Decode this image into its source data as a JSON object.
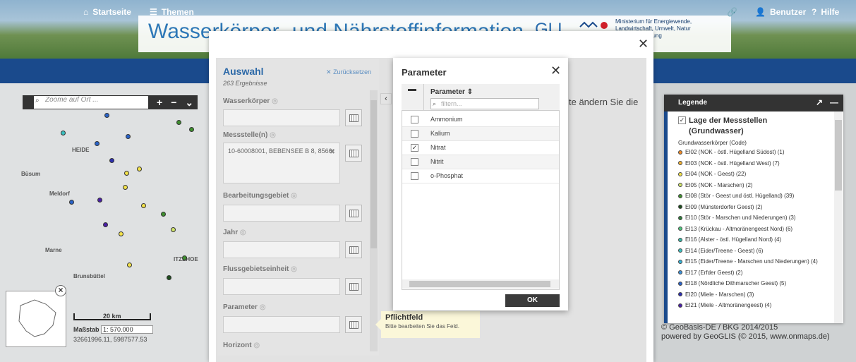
{
  "header": {
    "site_title": "Wasserkörper- und Nährstoffinformation",
    "brand": "GLI",
    "ministry_lines": [
      "Ministerium für Energiewende,",
      "Landwirtschaft, Umwelt, Natur",
      "und Digitalisierung"
    ],
    "nav": {
      "start": "Startseite",
      "themes": "Themen",
      "user": "Benutzer",
      "help": "Hilfe"
    }
  },
  "map": {
    "zoom_placeholder": "Zoome auf Ort ...",
    "scale_label": "20 km",
    "massstab_label": "Maßstab",
    "massstab_value": "1: 570.000",
    "coords": "32661996.11, 5987577.53",
    "places": [
      "HEIDE",
      "Meldorf",
      "Marne",
      "Brunsbüttel",
      "ITZEHOE",
      "Büsum"
    ],
    "background_text": "te ändern Sie die"
  },
  "auswahl": {
    "title": "Auswahl",
    "count": "263 Ergebnisse",
    "reset": "Zurücksetzen",
    "fields": {
      "wasserkoerper": "Wasserkörper",
      "messstelle": "Messstelle(n)",
      "bearbeitungsgebiet": "Bearbeitungsgebiet",
      "jahr": "Jahr",
      "flussgebietseinheit": "Flussgebietseinheit",
      "parameter": "Parameter",
      "horizont": "Horizont"
    },
    "messstelle_tag": "10-60008001, BEBENSEE B 8, 8566"
  },
  "tooltip": {
    "title": "Pflichtfeld",
    "message": "Bitte bearbeiten Sie das Feld."
  },
  "parameter_dialog": {
    "title": "Parameter",
    "column": "Parameter",
    "filter_placeholder": "filtern...",
    "rows": [
      {
        "label": "Ammonium",
        "checked": false
      },
      {
        "label": "Kalium",
        "checked": false
      },
      {
        "label": "Nitrat",
        "checked": true
      },
      {
        "label": "Nitrit",
        "checked": false
      },
      {
        "label": "o-Phosphat",
        "checked": false
      }
    ],
    "ok": "OK"
  },
  "legend": {
    "header": "Legende",
    "layer_title_1": "Lage der Messstellen",
    "layer_title_2": "(Grundwasser)",
    "subtitle": "Grundwasserkörper (Code)",
    "items": [
      {
        "label": "EI02 (NOK - östl. Hügelland Südost) (1)",
        "color": "#f08a24"
      },
      {
        "label": "EI03 (NOK - östl. Hügelland West) (7)",
        "color": "#f2b233"
      },
      {
        "label": "EI04 (NOK - Geest) (22)",
        "color": "#f3e24a"
      },
      {
        "label": "EI05 (NOK - Marschen) (2)",
        "color": "#cfe36b"
      },
      {
        "label": "EI08 (Stör - Geest und östl. Hügelland) (39)",
        "color": "#3f8f2f"
      },
      {
        "label": "EI09 (Münsterdorfer Geest) (2)",
        "color": "#1d4d1d"
      },
      {
        "label": "EI10 (Stör - Marschen und Niederungen) (3)",
        "color": "#2f7a3a"
      },
      {
        "label": "EI13 (Krückau - Altmoränengeest Nord) (6)",
        "color": "#4bc27a"
      },
      {
        "label": "EI16 (Alster - östl. Hügelland Nord) (4)",
        "color": "#3ab8a8"
      },
      {
        "label": "EI14 (Eider/Treene - Geest) (6)",
        "color": "#3ac0c0"
      },
      {
        "label": "EI15 (Eider/Treene - Marschen und Niederungen) (4)",
        "color": "#35b2d6"
      },
      {
        "label": "EI17 (Erfder Geest) (2)",
        "color": "#3b8fd6"
      },
      {
        "label": "EI18 (Nördliche Dithmarscher Geest) (5)",
        "color": "#2a63c8"
      },
      {
        "label": "EI20 (Miele - Marschen) (3)",
        "color": "#2d2fb0"
      },
      {
        "label": "EI21 (Miele - Altmoränengeest) (4)",
        "color": "#4a1fa6"
      }
    ]
  },
  "copyright": {
    "line1": "© GeoBasis-DE / BKG 2014/2015",
    "line2": "powered by GeoGLIS (© 2015, www.onmaps.de)"
  }
}
